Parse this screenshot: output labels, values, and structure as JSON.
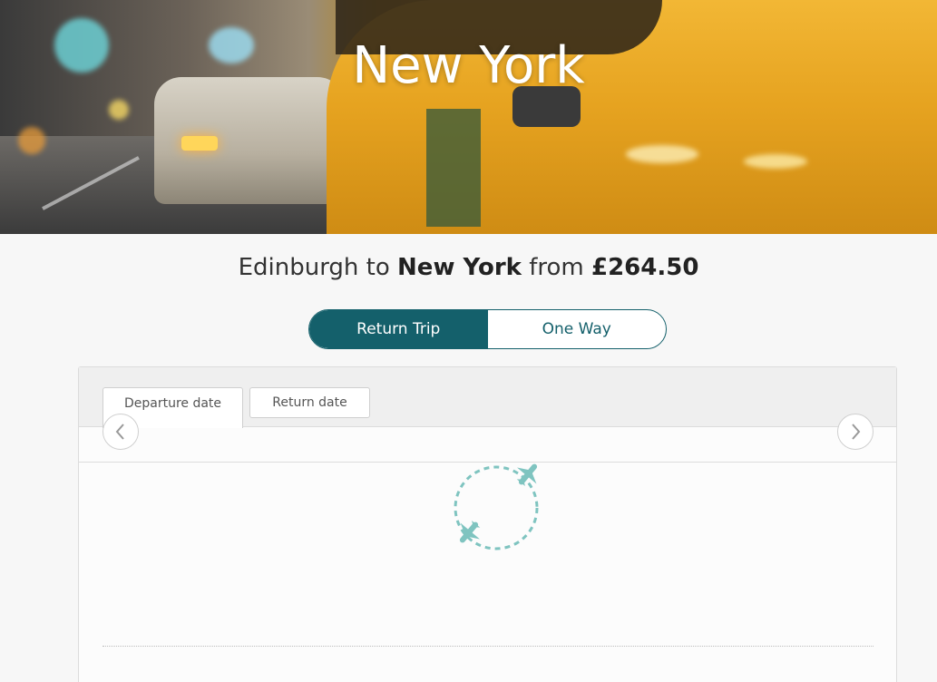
{
  "hero": {
    "title": "New York"
  },
  "headline": {
    "prefix": "Edinburgh to ",
    "destination": "New York",
    "middle": " from ",
    "price": "£264.50"
  },
  "trip_type": {
    "options": [
      "Return Trip",
      "One Way"
    ],
    "selected": "Return Trip"
  },
  "date_tabs": {
    "departure": "Departure date",
    "return": "Return date",
    "active": "Departure date"
  },
  "nav": {
    "prev_icon": "chevron-left-icon",
    "next_icon": "chevron-right-icon"
  },
  "loader": {
    "icon": "plane-loading-icon",
    "color": "#7fc4c0"
  },
  "colors": {
    "accent": "#14606b"
  }
}
